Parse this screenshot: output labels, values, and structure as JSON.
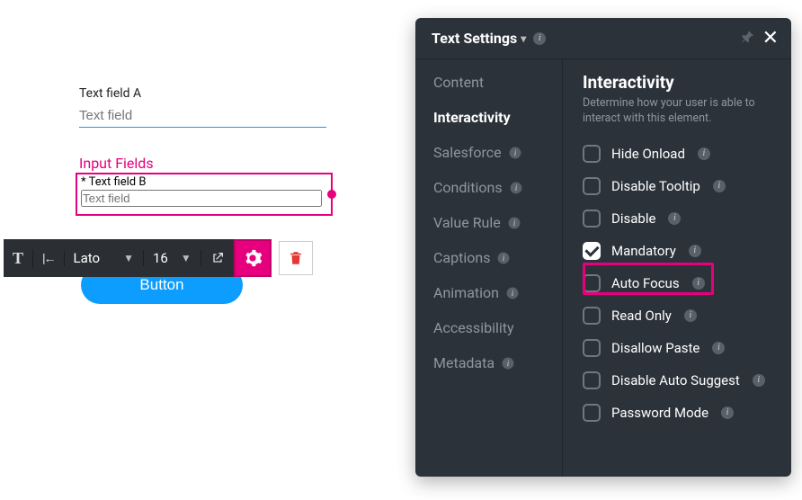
{
  "canvas": {
    "fieldA": {
      "label": "Text field A",
      "placeholder": "Text field"
    },
    "group_label": "Input Fields",
    "fieldB": {
      "label": "* Text field B",
      "placeholder": "Text field"
    },
    "button_label": "Button"
  },
  "toolbar": {
    "text_icon": "T",
    "indent_icon": "|←",
    "font": "Lato",
    "size": "16"
  },
  "panel": {
    "title": "Text Settings",
    "side": [
      {
        "label": "Content"
      },
      {
        "label": "Interactivity",
        "active": true
      },
      {
        "label": "Salesforce",
        "info": true
      },
      {
        "label": "Conditions",
        "info": true
      },
      {
        "label": "Value Rule",
        "info": true
      },
      {
        "label": "Captions",
        "info": true
      },
      {
        "label": "Animation",
        "info": true
      },
      {
        "label": "Accessibility"
      },
      {
        "label": "Metadata",
        "info": true
      }
    ],
    "section_title": "Interactivity",
    "section_desc": "Determine how your user is able to interact with this element.",
    "options": [
      {
        "label": "Hide Onload",
        "checked": false
      },
      {
        "label": "Disable Tooltip",
        "checked": false
      },
      {
        "label": "Disable",
        "checked": false
      },
      {
        "label": "Mandatory",
        "checked": true
      },
      {
        "label": "Auto Focus",
        "checked": false
      },
      {
        "label": "Read Only",
        "checked": false
      },
      {
        "label": "Disallow Paste",
        "checked": false
      },
      {
        "label": "Disable Auto Suggest",
        "checked": false
      },
      {
        "label": "Password Mode",
        "checked": false
      }
    ]
  }
}
